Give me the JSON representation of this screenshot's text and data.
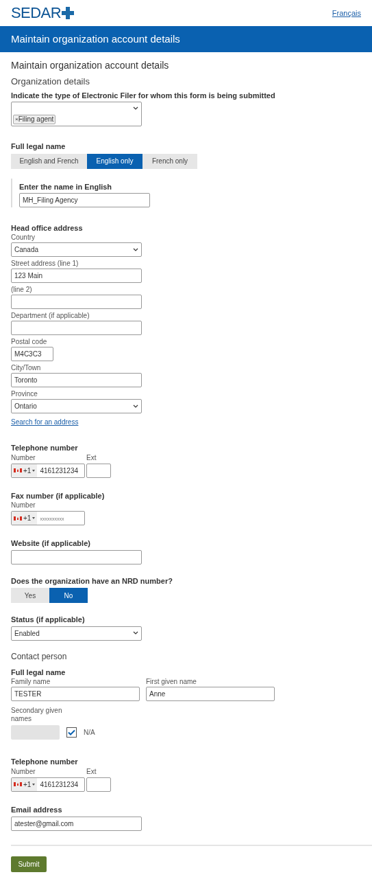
{
  "header": {
    "logo": "SEDAR",
    "language_link": "Français"
  },
  "banner_title": "Maintain organization account details",
  "page_title": "Maintain organization account details",
  "section_title": "Organization details",
  "filer_type": {
    "label": "Indicate the type of Electronic Filer for whom this form is being submitted",
    "tags": [
      {
        "remove": "×",
        "label": "Filing agent"
      }
    ]
  },
  "legal_name": {
    "label": "Full legal name",
    "options": [
      {
        "label": "English and French",
        "selected": false
      },
      {
        "label": "English only",
        "selected": true
      },
      {
        "label": "French only",
        "selected": false
      }
    ],
    "english_name": {
      "label": "Enter the name in English",
      "value": "MH_Filing Agency"
    }
  },
  "head_office": {
    "label": "Head office address",
    "fields": [
      {
        "kind": "select",
        "label": "Country",
        "value": "Canada"
      },
      {
        "kind": "text",
        "label": "Street address (line 1)",
        "value": "123 Main"
      },
      {
        "kind": "text",
        "label": "(line 2)"
      },
      {
        "kind": "text",
        "label": "Department (if applicable)"
      },
      {
        "kind": "short",
        "label": "Postal code",
        "value": "M4C3C3"
      },
      {
        "kind": "text",
        "label": "City/Town",
        "value": "Toronto"
      },
      {
        "kind": "select",
        "label": "Province",
        "value": "Ontario"
      }
    ],
    "search_link": "Search for an address"
  },
  "telephone": {
    "label": "Telephone number",
    "number_label": "Number",
    "ext_label": "Ext",
    "country_code": "+1",
    "value": "4161231234"
  },
  "fax": {
    "label": "Fax number (if applicable)",
    "number_label": "Number",
    "country_code": "+1",
    "placeholder": "xxxxxxxxxx"
  },
  "website": {
    "label": "Website (if applicable)"
  },
  "nrd": {
    "label": "Does the organization have an NRD number?",
    "options": [
      {
        "label": "Yes",
        "selected": false
      },
      {
        "label": "No",
        "selected": true
      }
    ]
  },
  "status": {
    "label": "Status (if applicable)",
    "value": "Enabled"
  },
  "contact_title": "Contact person",
  "contact": {
    "label": "Full legal name",
    "family_name": {
      "label": "Family name",
      "value": "TESTER"
    },
    "first_given_name": {
      "label": "First given name",
      "value": "Anne"
    },
    "secondary_given_names": {
      "label": "Secondary given names",
      "disabled": true
    },
    "not_applicable": {
      "label": "N/A",
      "checked": true
    }
  },
  "contact_telephone": {
    "label": "Telephone number",
    "number_label": "Number",
    "ext_label": "Ext",
    "country_code": "+1",
    "value": "4161231234"
  },
  "email": {
    "label": "Email address",
    "value": "atester@gmail.com"
  },
  "submit": "Submit"
}
